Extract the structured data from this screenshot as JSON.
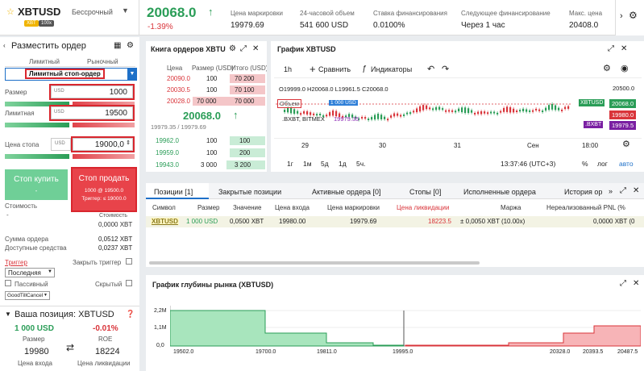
{
  "topbar": {
    "symbol": "XBTUSD",
    "contract": "Бессрочный",
    "badge1": "XBT",
    "badge2": "100x",
    "price": "20068.0",
    "change": "-1.39%",
    "stats": [
      {
        "label": "Цена маркировки",
        "value": "19979.69"
      },
      {
        "label": "24-часовой объем",
        "value": "541 600 USD"
      },
      {
        "label": "Ставка финансирования",
        "value": "0.0100%"
      },
      {
        "label": "Следующее финансирование",
        "value": "Через 1 час"
      },
      {
        "label": "Макс. цена",
        "value": "20408.0"
      }
    ]
  },
  "order": {
    "title": "Разместить ордер",
    "tab_limit": "Лимитный",
    "tab_market": "Рыночный",
    "type_selected": "Лимитный стоп-ордер",
    "size_label": "Размер",
    "size_unit": "USD",
    "size_value": "1000",
    "limit_label": "Лимитная",
    "limit_unit": "USD",
    "limit_value": "19500",
    "stop_label": "Цена стопа",
    "stop_unit": "USD",
    "stop_value": "19000,0",
    "buy_btn": "Стоп купить",
    "buy_sub": "-",
    "sell_btn": "Стоп продать",
    "sell_sub1": "1000 @ 19500.0",
    "sell_sub2": "Триггер: ≤ 19000.0",
    "cost_label": "Стоимость",
    "cost_left": "-",
    "cost_right_top": "Стоимость",
    "cost_right": "0,0000 XBT",
    "order_sum_label": "Сумма ордера",
    "order_sum": "0,0512 XBT",
    "avail_label": "Доступные средства",
    "avail": "0,0237 XBT",
    "trigger_label": "Триггер",
    "close_trigger": "Закрыть триггер",
    "trigger_select": "Последняя",
    "passive": "Пассивный",
    "hidden": "Скрытый",
    "tif": "GoodTillCancel"
  },
  "position": {
    "title": "Ваша позиция: XBTUSD",
    "size": "1 000 USD",
    "size_label": "Размер",
    "roe": "-0.01%",
    "roe_label": "ROE",
    "entry": "19980",
    "entry_label": "Цена входа",
    "liq": "18224",
    "liq_label": "Цена ликвидации"
  },
  "orderbook": {
    "title": "Книга ордеров XBTU",
    "headers": [
      "Цена",
      "Размер (USD)",
      "Итого (USD)"
    ],
    "asks": [
      [
        "20090.0",
        "100",
        "70 200"
      ],
      [
        "20030.5",
        "100",
        "70 100"
      ],
      [
        "20028.0",
        "70 000",
        "70 000"
      ]
    ],
    "mid": "20068.0",
    "mid_sub": "19979.35 / 19979.69",
    "bids": [
      [
        "19962.0",
        "100",
        "100"
      ],
      [
        "19959.0",
        "100",
        "200"
      ],
      [
        "19943.0",
        "3 000",
        "3 200"
      ]
    ]
  },
  "chart": {
    "title": "График XBTUSD",
    "interval": "1h",
    "compare": "Сравнить",
    "indicators": "Индикаторы",
    "ohlc": "O19999.0 H20068.0 L19961.5 C20068.0",
    "volume_label": "Объем",
    "volume_val": "1 000 USD",
    "bxbt": ".BXBT, BITMEX",
    "bxbt_val": "19979.35",
    "price_top": "20500.0",
    "tag_last": "XBTUSD",
    "tag_last_val": "20068.0",
    "tag_red": "19980.0",
    "tag_bxbt": ".BXBT",
    "tag_bxbt_val": "19979.5",
    "xticks": [
      "29",
      "30",
      "31",
      "Сен",
      "18:00"
    ],
    "ranges": [
      "1г",
      "1м",
      "5д",
      "1д",
      "5ч."
    ],
    "time": "13:37:46 (UTC+3)",
    "pct": "%",
    "log": "лог",
    "auto": "авто"
  },
  "tabs": [
    "Позиции [1]",
    "Закрытые позиции",
    "Активные ордера [0]",
    "Стопы [0]",
    "Исполненные ордера",
    "История ор"
  ],
  "positions": {
    "headers": [
      "Символ",
      "Размер",
      "Значение",
      "Цена входа",
      "Цена маркировки",
      "Цена ликвидации",
      "Маржа",
      "Нереализованный PNL (%"
    ],
    "row": [
      "XBTUSD",
      "1 000 USD",
      "0,0500 XBT",
      "19980.00",
      "19979.69",
      "18223.5",
      "± 0,0050 XBT (10.00x)",
      "0,0000 XBT (0"
    ]
  },
  "depth": {
    "title": "График глубины рынка (XBTUSD)",
    "yticks": [
      "2,2M",
      "1,1M",
      "0,0"
    ],
    "xticks": [
      "19502.0",
      "19700.0",
      "19811.0",
      "19995.0",
      "20328.0",
      "20393.5",
      "20487.5"
    ]
  },
  "colors": {
    "green": "#2a9d57",
    "red": "#d9343a",
    "accent": "#1e70c8"
  }
}
